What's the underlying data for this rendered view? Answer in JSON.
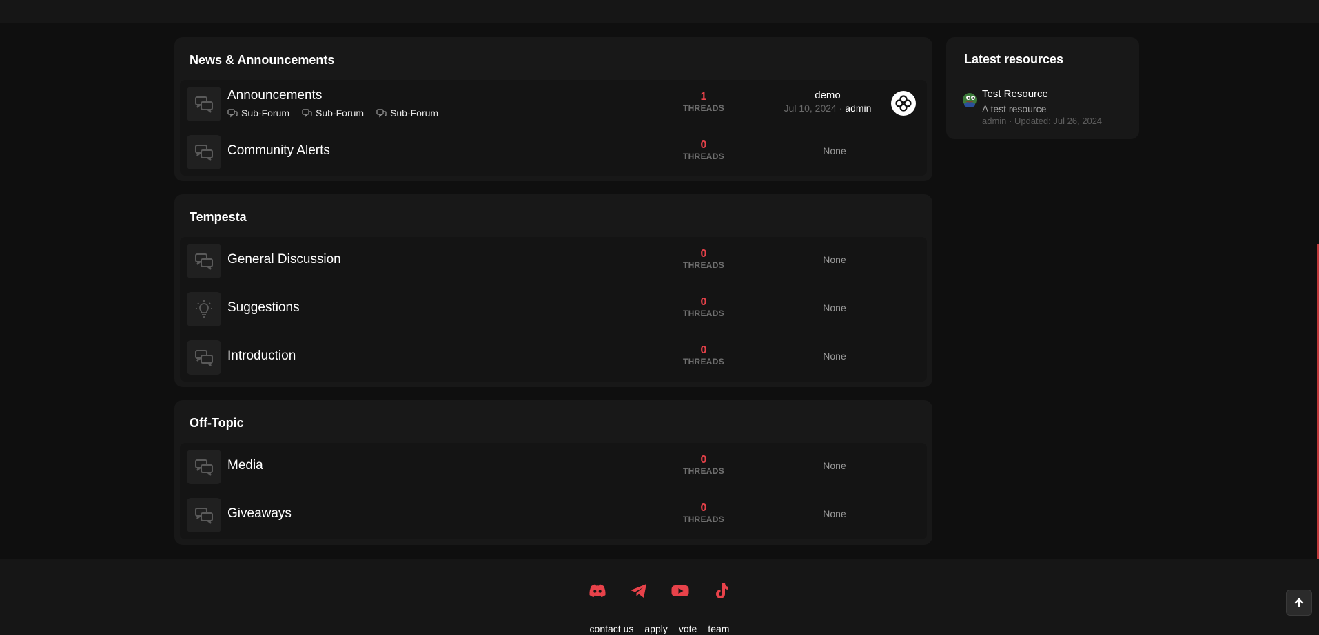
{
  "colors": {
    "accent": "#e8424a",
    "background": "#0f0f0f",
    "panel": "#181818",
    "muted": "#6f6f6f"
  },
  "categories": [
    {
      "title": "News & Announcements",
      "forums": [
        {
          "title": "Announcements",
          "icon": "chat-bubbles-icon",
          "subforums": [
            "Sub-Forum",
            "Sub-Forum",
            "Sub-Forum"
          ],
          "threads_count": "1",
          "threads_label": "THREADS",
          "last_post": {
            "title": "demo",
            "date": "Jul 10, 2024",
            "separator": "·",
            "user": "admin"
          }
        },
        {
          "title": "Community Alerts",
          "icon": "chat-bubbles-icon",
          "threads_count": "0",
          "threads_label": "THREADS",
          "last_post_none": "None"
        }
      ]
    },
    {
      "title": "Tempesta",
      "forums": [
        {
          "title": "General Discussion",
          "icon": "chat-bubbles-icon",
          "threads_count": "0",
          "threads_label": "THREADS",
          "last_post_none": "None"
        },
        {
          "title": "Suggestions",
          "icon": "lightbulb-icon",
          "threads_count": "0",
          "threads_label": "THREADS",
          "last_post_none": "None"
        },
        {
          "title": "Introduction",
          "icon": "chat-bubbles-icon",
          "threads_count": "0",
          "threads_label": "THREADS",
          "last_post_none": "None"
        }
      ]
    },
    {
      "title": "Off-Topic",
      "forums": [
        {
          "title": "Media",
          "icon": "chat-bubbles-icon",
          "threads_count": "0",
          "threads_label": "THREADS",
          "last_post_none": "None"
        },
        {
          "title": "Giveaways",
          "icon": "chat-bubbles-icon",
          "threads_count": "0",
          "threads_label": "THREADS",
          "last_post_none": "None"
        }
      ]
    }
  ],
  "sidebar": {
    "title": "Latest resources",
    "resource": {
      "title": "Test Resource",
      "description": "A test resource",
      "meta": "admin · Updated: Jul 26, 2024"
    }
  },
  "footer": {
    "social": [
      "discord-icon",
      "telegram-icon",
      "youtube-icon",
      "tiktok-icon"
    ],
    "links": [
      "contact us",
      "apply",
      "vote",
      "team"
    ]
  }
}
